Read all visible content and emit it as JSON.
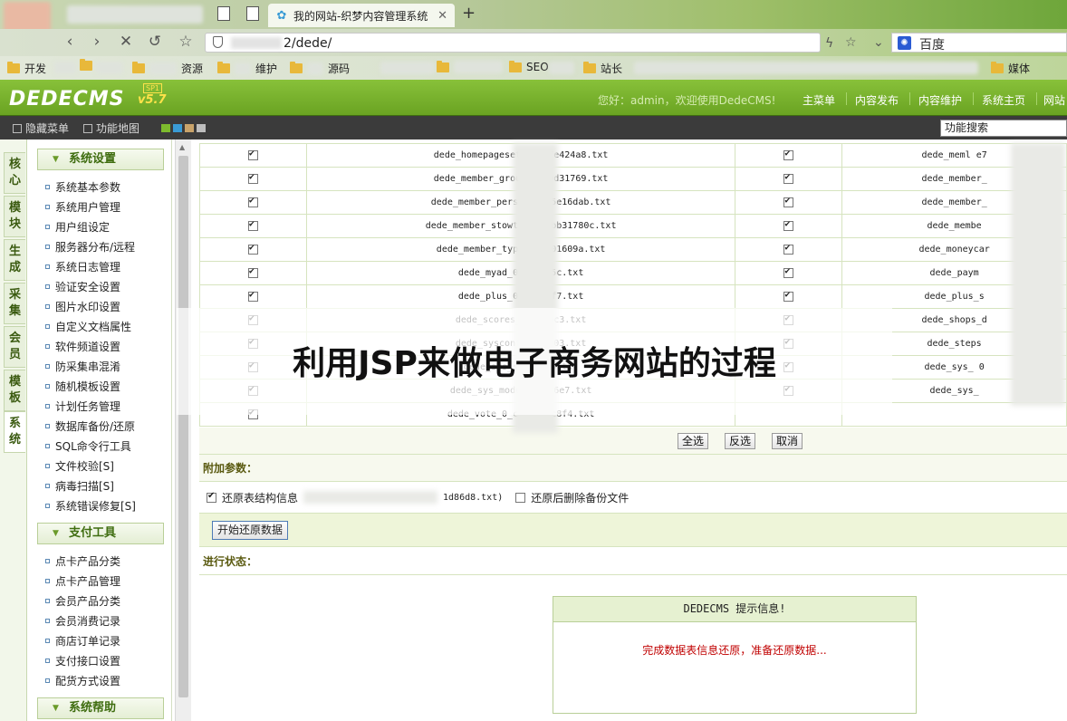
{
  "browser": {
    "active_tab_title": "我的网站-织梦内容管理系统",
    "address_visible": "2/dede/",
    "search_engine": "百度",
    "bookmarks": [
      "开发",
      "资源",
      "维护",
      "源码",
      "SEO",
      "站长",
      "媒体"
    ]
  },
  "header": {
    "logo": "DEDECMS",
    "version": "v5.7",
    "sp": "SP1",
    "greeting": "您好：admin，欢迎使用DedeCMS!",
    "nav": [
      "主菜单",
      "内容发布",
      "内容维护",
      "系统主页",
      "网站"
    ]
  },
  "toolbar": {
    "hide_menu": "隐藏菜单",
    "site_map": "功能地图",
    "search_value": "功能搜索",
    "skin_colors": [
      "#7dbb2e",
      "#3a9bd5",
      "#c9a36a",
      "#bdbdbd"
    ]
  },
  "vtabs": [
    "核心",
    "模块",
    "生成",
    "采集",
    "会员",
    "模板",
    "系统"
  ],
  "menu": {
    "sections": [
      {
        "title": "系统设置",
        "items": [
          "系统基本参数",
          "系统用户管理",
          "用户组设定",
          "服务器分布/远程",
          "系统日志管理",
          "验证安全设置",
          "图片水印设置",
          "自定义文档属性",
          "软件频道设置",
          "防采集串混淆",
          "随机模板设置",
          "计划任务管理",
          "数据库备份/还原",
          "SQL命令行工具",
          "文件校验[S]",
          "病毒扫描[S]",
          "系统错误修复[S]"
        ]
      },
      {
        "title": "支付工具",
        "items": [
          "点卡产品分类",
          "点卡产品管理",
          "会员产品分类",
          "会员消费记录",
          "商店订单记录",
          "支付接口设置",
          "配货方式设置"
        ]
      },
      {
        "title": "系统帮助",
        "items": []
      }
    ]
  },
  "table": {
    "rows": [
      {
        "left": "dede_homepageset_0          027e424a8.txt",
        "right": "dede_meml          e7"
      },
      {
        "left": "dede_member_group_0          90d31769.txt",
        "right": "dede_member_"
      },
      {
        "left": "dede_member_person_          725e16dab.txt",
        "right": "dede_member_"
      },
      {
        "left": "dede_member_stowtype          01bb31780c.txt",
        "right": "dede_membe"
      },
      {
        "left": "dede_member_type_0          2301609a.txt",
        "right": "dede_moneycar"
      },
      {
        "left": "dede_myad_0_1          e8a5c.txt",
        "right": "dede_paym"
      },
      {
        "left": "dede_plus_0_c          609f7.txt",
        "right": "dede_plus_s"
      },
      {
        "left": "dede_scores_0          c1b0c3.txt",
        "right": "dede_shops_d"
      },
      {
        "left": "dede_sysconfig          16903.txt",
        "right": "dede_steps"
      },
      {
        "left": "dede_sys_set          1c13.txt",
        "right": "dede_sys_        0"
      },
      {
        "left": "dede_sys_module          2926e7.txt",
        "right": "dede_sys_"
      },
      {
        "left": "dede_vote_0_cb          9111c8f4.txt",
        "right": ""
      }
    ],
    "select_all": "全选",
    "invert": "反选",
    "cancel": "取消"
  },
  "params": {
    "title": "附加参数：",
    "restore_structure_label": "还原表结构信息",
    "restore_structure_file": "1d86d8.txt)",
    "delete_after_label": "还原后删除备份文件",
    "start_button": "开始还原数据"
  },
  "progress": {
    "title": "进行状态：",
    "box_title": "DEDECMS 提示信息!",
    "message": "完成数据表信息还原，准备还原数据..."
  },
  "overlay": {
    "title": "利用JSP来做电子商务网站的过程"
  }
}
